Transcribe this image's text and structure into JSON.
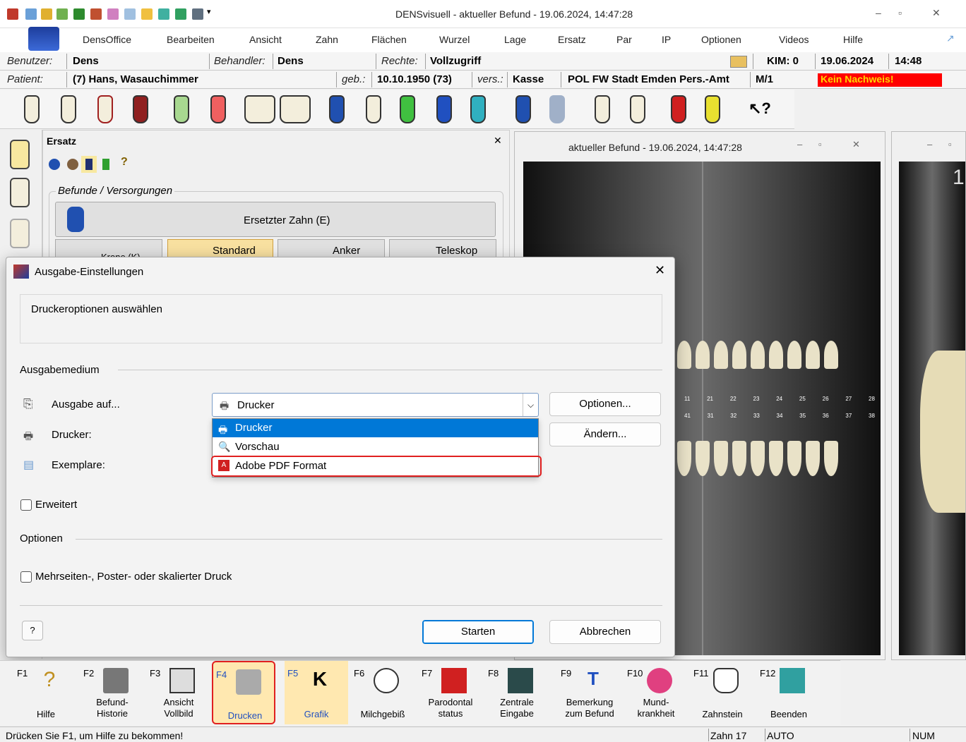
{
  "window": {
    "title": "DENSvisuell -  aktueller Befund - 19.06.2024, 14:47:28"
  },
  "menu": [
    "DensOffice",
    "Bearbeiten",
    "Ansicht",
    "Zahn",
    "Flächen",
    "Wurzel",
    "Lage",
    "Ersatz",
    "Par",
    "IP",
    "Optionen",
    "Videos",
    "Hilfe"
  ],
  "info1": {
    "benutzer_label": "Benutzer:",
    "benutzer": "Dens",
    "behandler_label": "Behandler:",
    "behandler": "Dens",
    "rechte_label": "Rechte:",
    "rechte": "Vollzugriff",
    "kim": "KIM: 0",
    "date": "19.06.2024",
    "time": "14:48"
  },
  "info2": {
    "patient_label": "Patient:",
    "patient": "(7) Hans, Wasauchimmer",
    "geb_label": "geb.:",
    "geb": "10.10.1950 (73)",
    "vers_label": "vers.:",
    "vers": "Kasse",
    "insurer": "POL FW Stadt  Emden Pers.-Amt",
    "m": "M/1",
    "nachweis": "Kein Nachweis!"
  },
  "ersatz": {
    "title": "Ersatz",
    "group": "Befunde / Versorgungen",
    "replaced": "Ersetzter Zahn (E)",
    "krone": "Krone (K)",
    "standard": "Standard",
    "anker": "Anker",
    "teleskop": "Teleskop"
  },
  "docwin": {
    "title": "aktueller Befund - 19.06.2024, 14:47:28",
    "upper_numbers": [
      "11",
      "21",
      "22",
      "23",
      "24",
      "25",
      "26",
      "27",
      "28"
    ],
    "lower_numbers": [
      "41",
      "31",
      "32",
      "33",
      "34",
      "35",
      "36",
      "37",
      "38"
    ],
    "side_number": "1"
  },
  "dialog": {
    "title": "Ausgabe-Einstellungen",
    "info": "Druckeroptionen auswählen",
    "group_medium": "Ausgabemedium",
    "ausgabe_label": "Ausgabe auf...",
    "drucker_label": "Drucker:",
    "exemplare_label": "Exemplare:",
    "selected": "Drucker",
    "options": [
      "Drucker",
      "Vorschau",
      "Adobe PDF Format"
    ],
    "optionen_btn": "Optionen...",
    "aendern_btn": "Ändern...",
    "erweitert": "Erweitert",
    "group_optionen": "Optionen",
    "mehrseiten": "Mehrseiten-, Poster- oder skalierter Druck",
    "starten": "Starten",
    "abbrechen": "Abbrechen"
  },
  "fkeys": [
    {
      "key": "F1",
      "label": "Hilfe"
    },
    {
      "key": "F2",
      "label": "Befund-\nHistorie"
    },
    {
      "key": "F3",
      "label": "Ansicht\nVollbild"
    },
    {
      "key": "F4",
      "label": "Drucken"
    },
    {
      "key": "F5",
      "label": "Grafik"
    },
    {
      "key": "F6",
      "label": "Milchgebiß"
    },
    {
      "key": "F7",
      "label": "Parodontal\nstatus"
    },
    {
      "key": "F8",
      "label": "Zentrale\nEingabe"
    },
    {
      "key": "F9",
      "label": "Bemerkung\nzum Befund"
    },
    {
      "key": "F10",
      "label": "Mund-\nkrankheit"
    },
    {
      "key": "F11",
      "label": "Zahnstein"
    },
    {
      "key": "F12",
      "label": "Beenden"
    }
  ],
  "status": {
    "help": "Drücken Sie F1, um Hilfe zu bekommen!",
    "zahn": "Zahn 17",
    "auto": "AUTO",
    "num": "NUM"
  },
  "colors": {
    "accent": "#0078d7",
    "highlight_red": "#e02020",
    "nachweis_bg": "#ff0000"
  }
}
